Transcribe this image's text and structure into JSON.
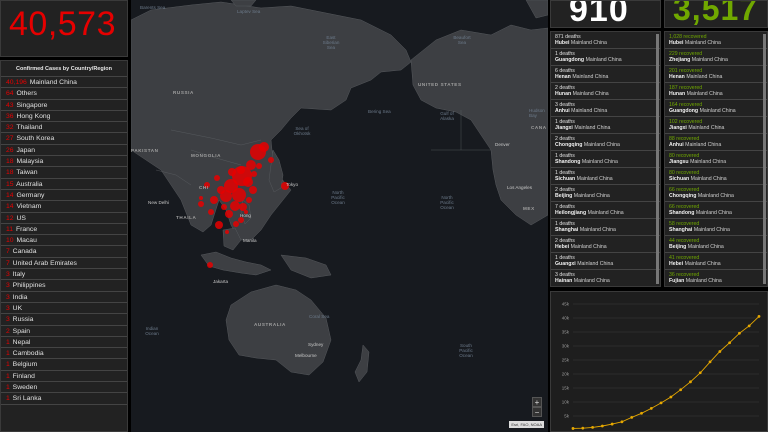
{
  "total_confirmed": {
    "value": "40,573"
  },
  "countries": {
    "title": "Confirmed Cases by Country/Region",
    "items": [
      {
        "count": "40,196",
        "name": "Mainland China"
      },
      {
        "count": "64",
        "name": "Others"
      },
      {
        "count": "43",
        "name": "Singapore"
      },
      {
        "count": "36",
        "name": "Hong Kong"
      },
      {
        "count": "32",
        "name": "Thailand"
      },
      {
        "count": "27",
        "name": "South Korea"
      },
      {
        "count": "26",
        "name": "Japan"
      },
      {
        "count": "18",
        "name": "Malaysia"
      },
      {
        "count": "18",
        "name": "Taiwan"
      },
      {
        "count": "15",
        "name": "Australia"
      },
      {
        "count": "14",
        "name": "Germany"
      },
      {
        "count": "14",
        "name": "Vietnam"
      },
      {
        "count": "12",
        "name": "US"
      },
      {
        "count": "11",
        "name": "France"
      },
      {
        "count": "10",
        "name": "Macau"
      },
      {
        "count": "7",
        "name": "Canada"
      },
      {
        "count": "7",
        "name": "United Arab Emirates"
      },
      {
        "count": "3",
        "name": "Italy"
      },
      {
        "count": "3",
        "name": "Philippines"
      },
      {
        "count": "3",
        "name": "India"
      },
      {
        "count": "3",
        "name": "UK"
      },
      {
        "count": "3",
        "name": "Russia"
      },
      {
        "count": "2",
        "name": "Spain"
      },
      {
        "count": "1",
        "name": "Nepal"
      },
      {
        "count": "1",
        "name": "Cambodia"
      },
      {
        "count": "1",
        "name": "Belgium"
      },
      {
        "count": "1",
        "name": "Finland"
      },
      {
        "count": "1",
        "name": "Sweden"
      },
      {
        "count": "1",
        "name": "Sri Lanka"
      }
    ]
  },
  "map": {
    "labels": {
      "barents_sea": "Barents Sea",
      "laptev_sea": "Laptev Sea",
      "east_siberian_sea": "East Siberian Sea",
      "beaufort_sea": "Beaufort Sea",
      "russia": "RUSSIA",
      "mongolia": "MONGOLIA",
      "china": "CHI",
      "pakistan": "PAKISTAN",
      "sea_of_okhotsk": "Sea of Okhotsk",
      "bering_sea": "Bering Sea",
      "gulf_of_alaska": "Gulf of Alaska",
      "united_states": "UNITED STATES",
      "hudson_bay": "Hudson Bay",
      "cana": "CANA",
      "denver": "Denver",
      "los_angeles": "Los Angeles",
      "tokyo": "Tokyo",
      "new_delhi": "New Delhi",
      "north_pacific_ocean_1": "North Pacific Ocean",
      "north_pacific_ocean_2": "North Pacific Ocean",
      "hong_kong": "Hong",
      "thailand": "THAILA",
      "manila": "Manila",
      "jakarta": "Jakarta",
      "indian_ocean": "Indian Ocean",
      "australia": "AUSTRALIA",
      "coral_sea": "Coral Sea",
      "sydney": "Sydney",
      "melbourne": "Melbourne",
      "south_pacific_ocean": "South Pacific Ocean",
      "mexico": "MEX"
    },
    "zoom_in": "+",
    "zoom_out": "−",
    "attribution": "Esri, FAO, NOAA",
    "marker_color": "#e60000"
  },
  "deaths": {
    "value": "910",
    "items": [
      {
        "count": "871 deaths",
        "region": "Hubei",
        "country": "Mainland China"
      },
      {
        "count": "1 deaths",
        "region": "Guangdong",
        "country": "Mainland China"
      },
      {
        "count": "6 deaths",
        "region": "Henan",
        "country": "Mainland China"
      },
      {
        "count": "2 deaths",
        "region": "Hunan",
        "country": "Mainland China"
      },
      {
        "count": "3 deaths",
        "region": "Anhui",
        "country": "Mainland China"
      },
      {
        "count": "1 deaths",
        "region": "Jiangxi",
        "country": "Mainland China"
      },
      {
        "count": "2 deaths",
        "region": "Chongqing",
        "country": "Mainland China"
      },
      {
        "count": "1 deaths",
        "region": "Shandong",
        "country": "Mainland China"
      },
      {
        "count": "1 deaths",
        "region": "Sichuan",
        "country": "Mainland China"
      },
      {
        "count": "2 deaths",
        "region": "Beijing",
        "country": "Mainland China"
      },
      {
        "count": "7 deaths",
        "region": "Heilongjiang",
        "country": "Mainland China"
      },
      {
        "count": "1 deaths",
        "region": "Shanghai",
        "country": "Mainland China"
      },
      {
        "count": "2 deaths",
        "region": "Hebei",
        "country": "Mainland China"
      },
      {
        "count": "1 deaths",
        "region": "Guangxi",
        "country": "Mainland China"
      },
      {
        "count": "3 deaths",
        "region": "Hainan",
        "country": "Mainland China"
      }
    ]
  },
  "recovered": {
    "value": "3,517",
    "items": [
      {
        "count": "1,028 recovered",
        "region": "Hubei",
        "country": "Mainland China"
      },
      {
        "count": "229 recovered",
        "region": "Zhejiang",
        "country": "Mainland China"
      },
      {
        "count": "201 recovered",
        "region": "Henan",
        "country": "Mainland China"
      },
      {
        "count": "187 recovered",
        "region": "Hunan",
        "country": "Mainland China"
      },
      {
        "count": "164 recovered",
        "region": "Guangdong",
        "country": "Mainland China"
      },
      {
        "count": "102 recovered",
        "region": "Jiangxi",
        "country": "Mainland China"
      },
      {
        "count": "88 recovered",
        "region": "Anhui",
        "country": "Mainland China"
      },
      {
        "count": "80 recovered",
        "region": "Jiangsu",
        "country": "Mainland China"
      },
      {
        "count": "80 recovered",
        "region": "Sichuan",
        "country": "Mainland China"
      },
      {
        "count": "66 recovered",
        "region": "Chongqing",
        "country": "Mainland China"
      },
      {
        "count": "66 recovered",
        "region": "Shandong",
        "country": "Mainland China"
      },
      {
        "count": "58 recovered",
        "region": "Shanghai",
        "country": "Mainland China"
      },
      {
        "count": "44 recovered",
        "region": "Beijing",
        "country": "Mainland China"
      },
      {
        "count": "41 recovered",
        "region": "Hebei",
        "country": "Mainland China"
      },
      {
        "count": "36 recovered",
        "region": "Fujian",
        "country": "Mainland China"
      }
    ]
  },
  "colors": {
    "confirmed": "#e60000",
    "deaths": "#ffffff",
    "recovered": "#70a800",
    "chart_line": "#e6a800"
  },
  "chart_data": {
    "type": "line",
    "y_tick_labels": [
      "45k",
      "40k",
      "35k",
      "30k",
      "25k",
      "20k",
      "15k",
      "10k",
      "5k"
    ],
    "ylim": [
      0,
      45000
    ],
    "x": [
      1,
      2,
      3,
      4,
      5,
      6,
      7,
      8,
      9,
      10,
      11,
      12,
      13,
      14,
      15,
      16,
      17,
      18,
      19,
      20
    ],
    "series": [
      {
        "color": "#e6a800",
        "values": [
          555,
          653,
          941,
          1438,
          2118,
          2927,
          4515,
          5974,
          7711,
          9692,
          11791,
          14380,
          17205,
          20438,
          24324,
          28018,
          31161,
          34546,
          37198,
          40573
        ]
      }
    ],
    "grid": true
  }
}
